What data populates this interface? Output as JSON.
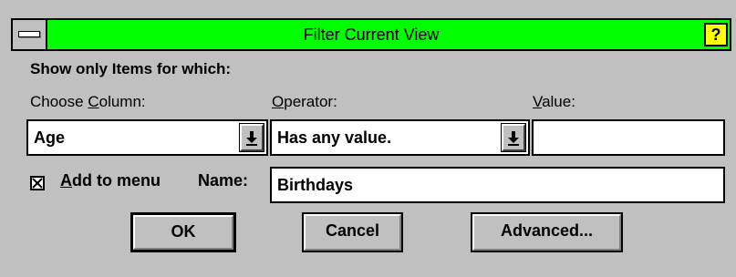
{
  "window": {
    "title": "Filter Current View",
    "help_label": "?"
  },
  "form": {
    "heading": "Show only Items for which:",
    "column_label_pre": "Choose ",
    "column_label_ul": "C",
    "column_label_post": "olumn:",
    "operator_label_ul": "O",
    "operator_label_post": "perator:",
    "value_label_ul": "V",
    "value_label_post": "alue:",
    "column_value": "Age",
    "operator_value": "Has any value.",
    "value_value": "",
    "add_to_menu_checked": true,
    "add_to_menu_mark": "X",
    "add_to_menu_label_ul": "A",
    "add_to_menu_label_post": "dd to menu",
    "name_label": "Name:",
    "name_value": "Birthdays"
  },
  "buttons": {
    "ok": "OK",
    "cancel": "Cancel",
    "advanced": "Advanced..."
  },
  "colors": {
    "titlebar": "#00ff00",
    "help_button": "#ffff00",
    "dialog_bg": "#c0c0c0"
  }
}
